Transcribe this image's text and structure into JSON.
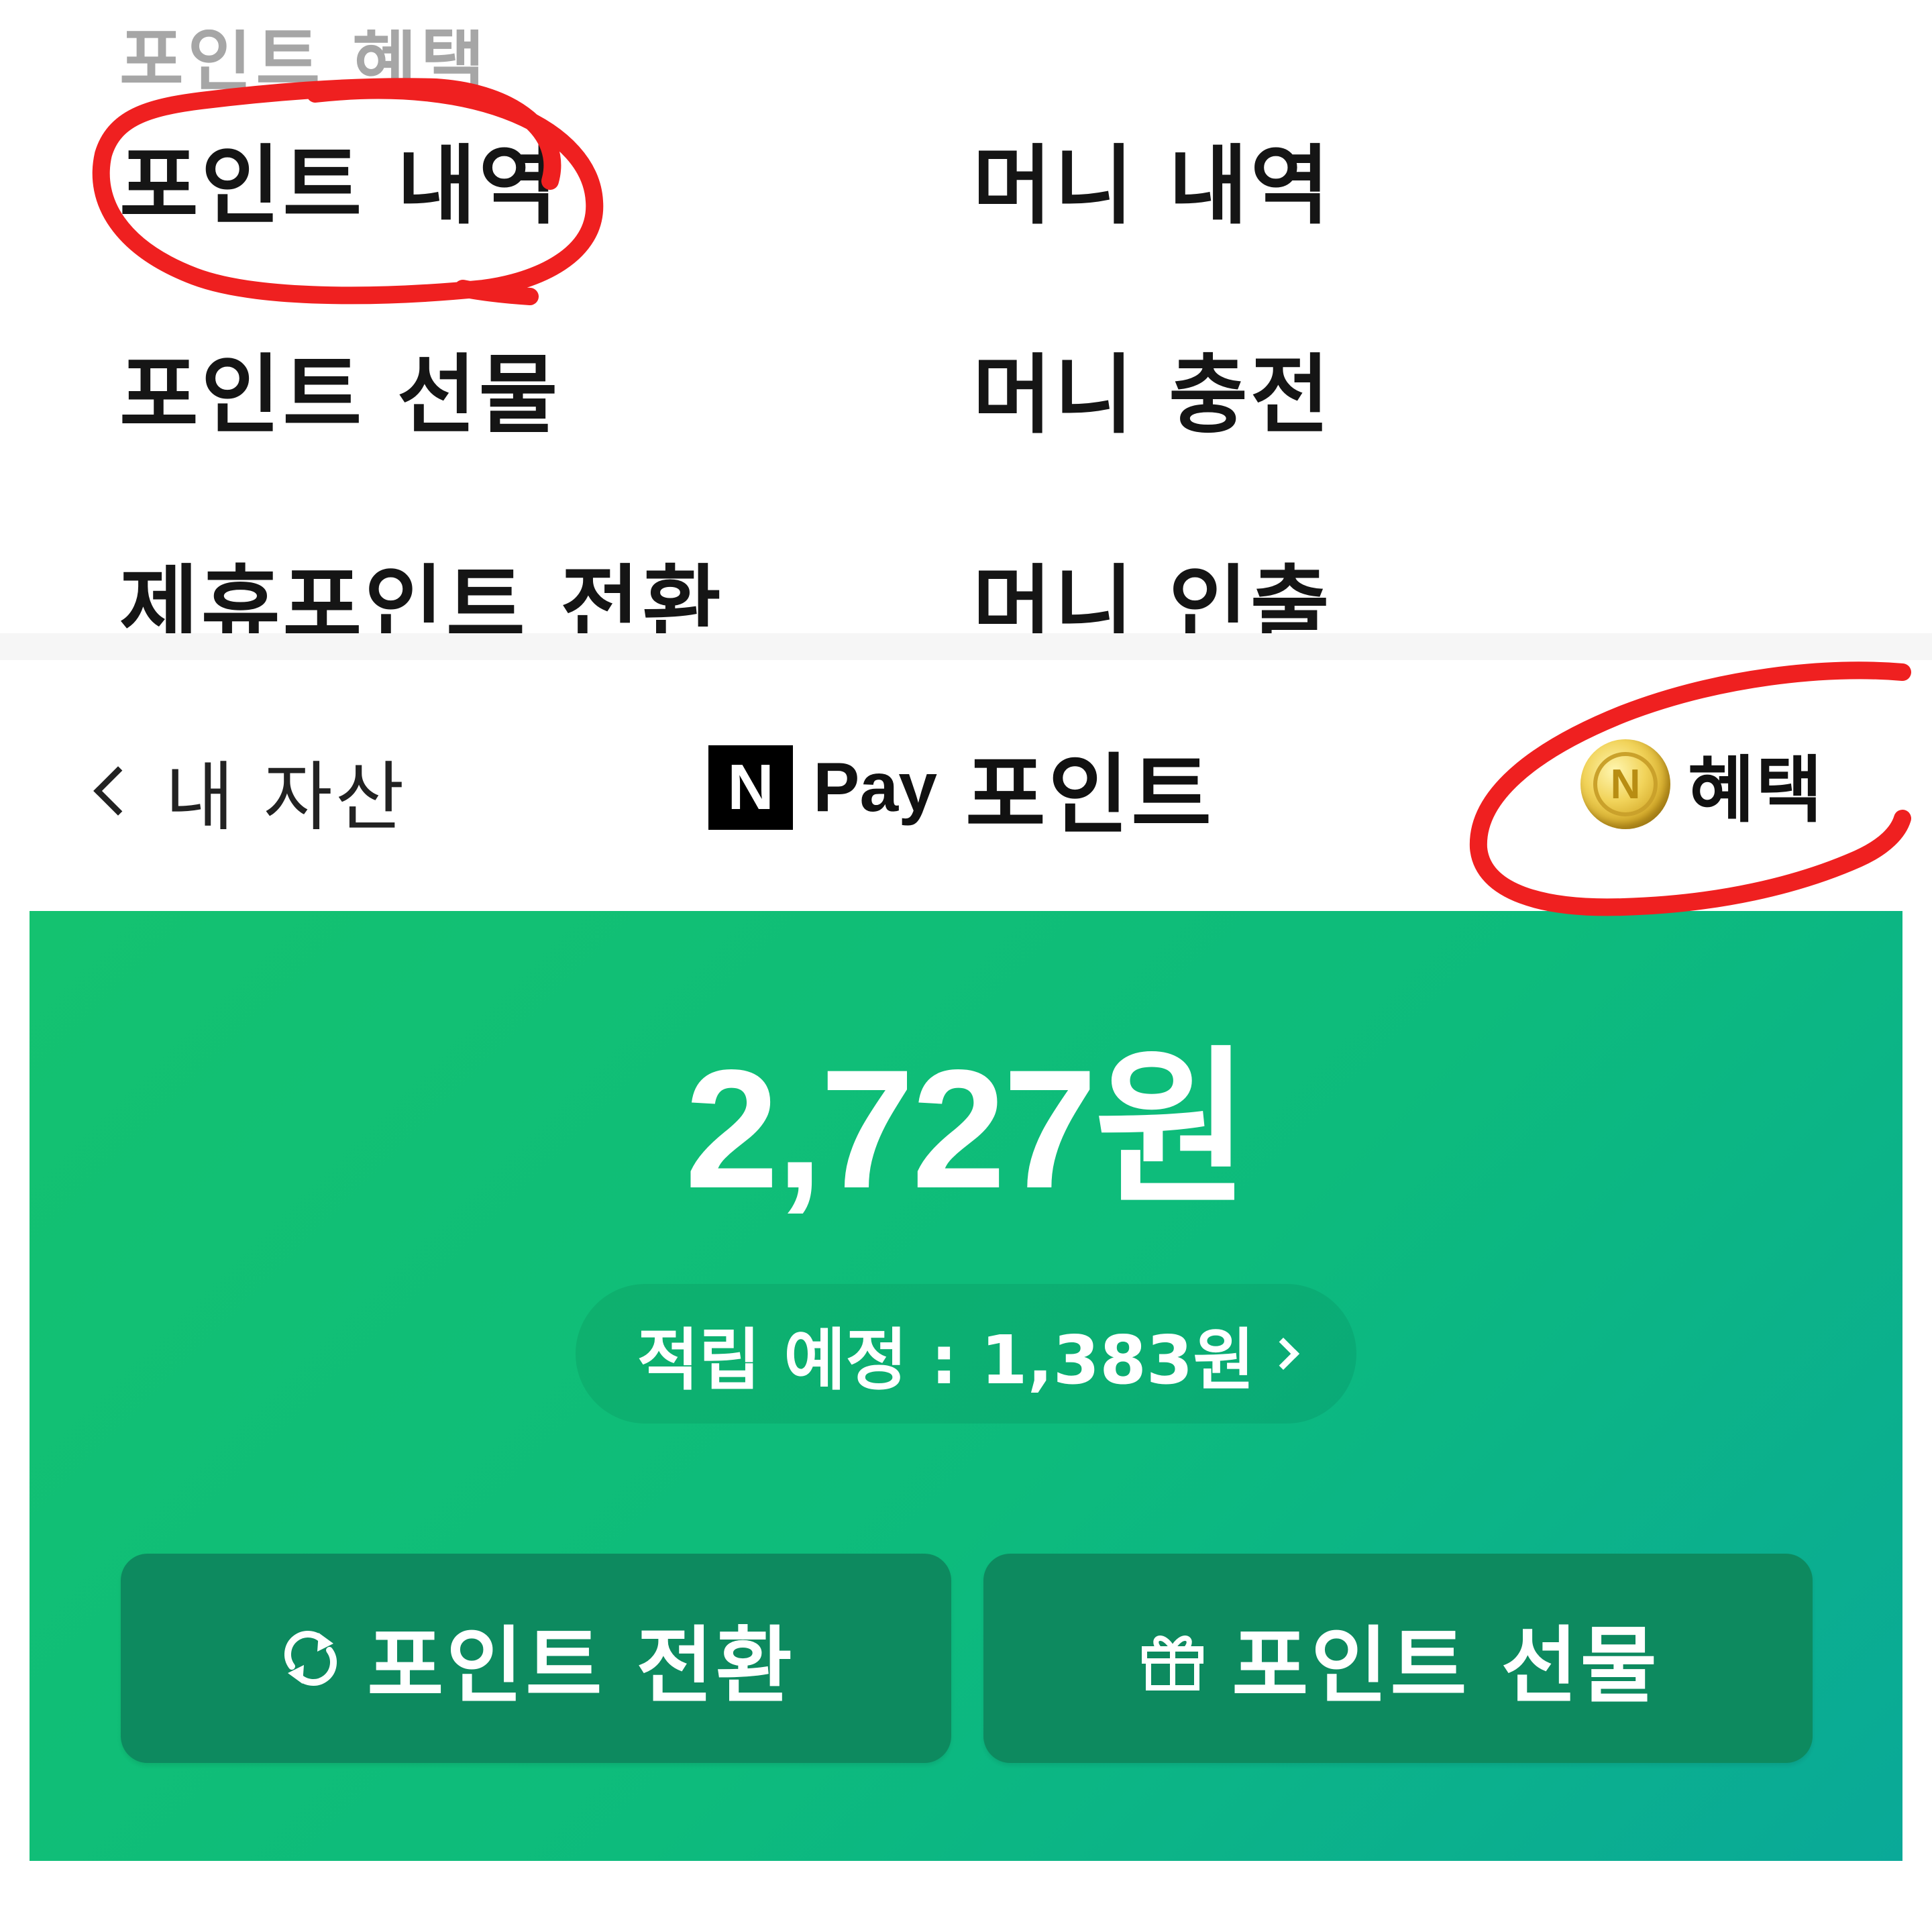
{
  "top_menu": {
    "cut_off_label": "포인트 혜택",
    "items": [
      {
        "label": "포인트 내역"
      },
      {
        "label": "머니 내역"
      },
      {
        "label": "포인트 선물"
      },
      {
        "label": "머니 충전"
      },
      {
        "label": "제휴포인트 전환"
      },
      {
        "label": "머니 인출"
      }
    ]
  },
  "header": {
    "back_label": "내 자산",
    "logo_letter": "N",
    "pay_word": "Pay",
    "title_word": "포인트",
    "benefit_label": "혜택",
    "coin_letter": "N"
  },
  "points": {
    "balance": "2,727원",
    "pending": "적립 예정 : 1,383원"
  },
  "actions": {
    "convert_label": "포인트 전환",
    "gift_label": "포인트 선물"
  },
  "colors": {
    "card_green": "#10bf76",
    "button_green": "#0d8a5f",
    "annotation_red": "#ef2020",
    "coin_gold": "#d8ad2a"
  },
  "icons": [
    "chevron-left-icon",
    "n-pay-logo",
    "coin-icon",
    "refresh-icon",
    "gift-icon",
    "chevron-right-icon"
  ]
}
